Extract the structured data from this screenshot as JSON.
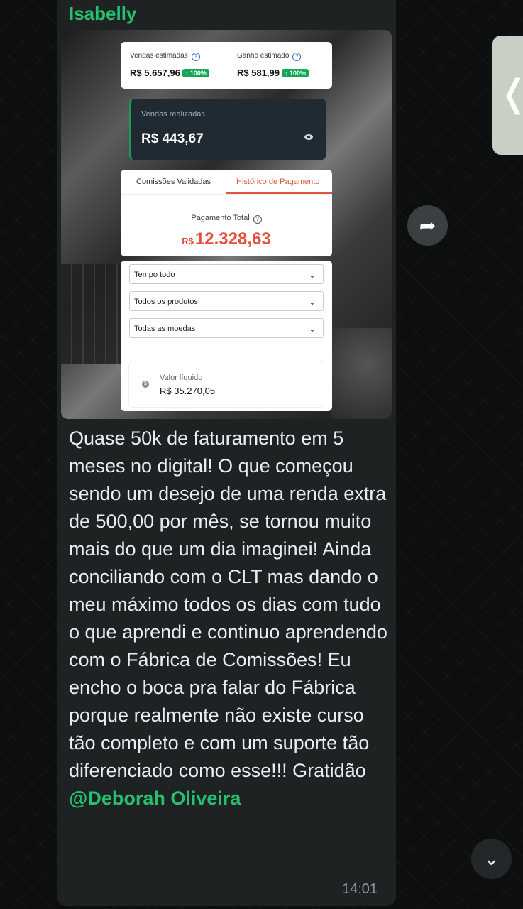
{
  "message": {
    "sender": "Isabelly",
    "caption_parts": {
      "text": "Quase 50k de faturamento em 5 meses no digital! O que começou sendo um desejo de uma renda extra de 500,00 por mês, se tornou muito mais do que um dia imaginei! Ainda conciliando com o CLT mas dando o meu máximo todos os dias com tudo o que aprendi e continuo aprendendo com o Fábrica de Comissões! Eu encho o boca pra falar do Fábrica porque realmente não existe curso tão completo e com um suporte tão diferenciado como esse!!! Gratidão ",
      "mention": "@Deborah Oliveira"
    },
    "time": "14:01"
  },
  "screenshot": {
    "estimated_sales_label": "Vendas estimadas",
    "estimated_sales_value": "R$ 5.657,96",
    "estimated_sales_badge": "↑ 100%",
    "estimated_gain_label": "Ganho estimado",
    "estimated_gain_value": "R$ 581,99",
    "estimated_gain_badge": "↑ 100%",
    "realized_label": "Vendas realizadas",
    "realized_value": "R$ 443,67",
    "tab_validated": "Comissões Validadas",
    "tab_history": "Histórico de Pagamento",
    "total_label": "Pagamento Total",
    "total_currency": "R$",
    "total_value": "12.328,63",
    "filter_period": "Tempo todo",
    "filter_products": "Todos os produtos",
    "filter_currency": "Todas as moedas",
    "net_label": "Valor líquido",
    "net_value": "R$ 35.270,05"
  },
  "icons": {
    "forward": "forward-icon",
    "back": "chevron-left-icon",
    "scroll": "chevron-down-icon"
  }
}
